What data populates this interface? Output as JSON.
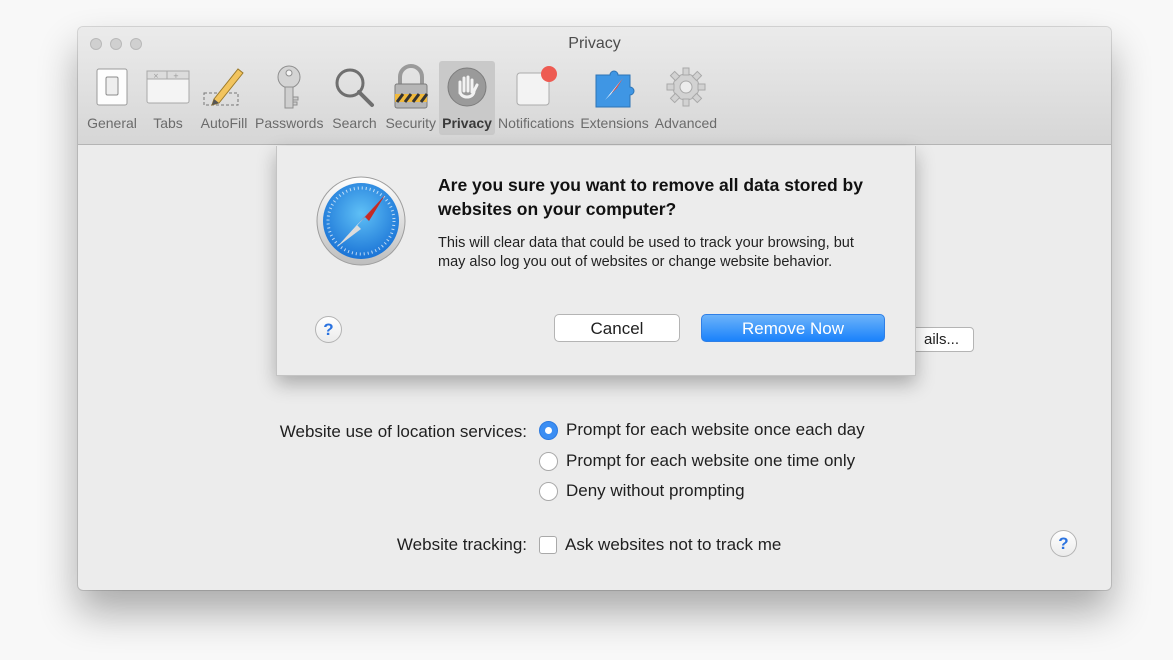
{
  "window": {
    "title": "Privacy"
  },
  "toolbar": {
    "items": [
      {
        "label": "General",
        "icon": "switch-icon"
      },
      {
        "label": "Tabs",
        "icon": "tabs-window-icon"
      },
      {
        "label": "AutoFill",
        "icon": "pencil-form-icon"
      },
      {
        "label": "Passwords",
        "icon": "key-icon"
      },
      {
        "label": "Search",
        "icon": "magnifier-icon"
      },
      {
        "label": "Security",
        "icon": "padlock-icon"
      },
      {
        "label": "Privacy",
        "icon": "hand-icon",
        "active": true
      },
      {
        "label": "Notifications",
        "icon": "notification-badge-icon"
      },
      {
        "label": "Extensions",
        "icon": "puzzle-compass-icon"
      },
      {
        "label": "Advanced",
        "icon": "gear-icon"
      }
    ]
  },
  "dialog": {
    "title": "Are you sure you want to remove all data stored by websites on your computer?",
    "message": "This will clear data that could be used to track your browsing, but may also log you out of websites or change website behavior.",
    "cancel_label": "Cancel",
    "confirm_label": "Remove Now",
    "help_label": "?"
  },
  "privacy": {
    "details_label": "ails...",
    "location_label": "Website use of location services:",
    "location_options": [
      {
        "label": "Prompt for each website once each day",
        "selected": true
      },
      {
        "label": "Prompt for each website one time only",
        "selected": false
      },
      {
        "label": "Deny without prompting",
        "selected": false
      }
    ],
    "tracking_label": "Website tracking:",
    "tracking_option": {
      "label": "Ask websites not to track me",
      "checked": false
    },
    "help_label": "?"
  },
  "colors": {
    "accent": "#3b8ef3",
    "button_primary": "#1a82fb"
  }
}
